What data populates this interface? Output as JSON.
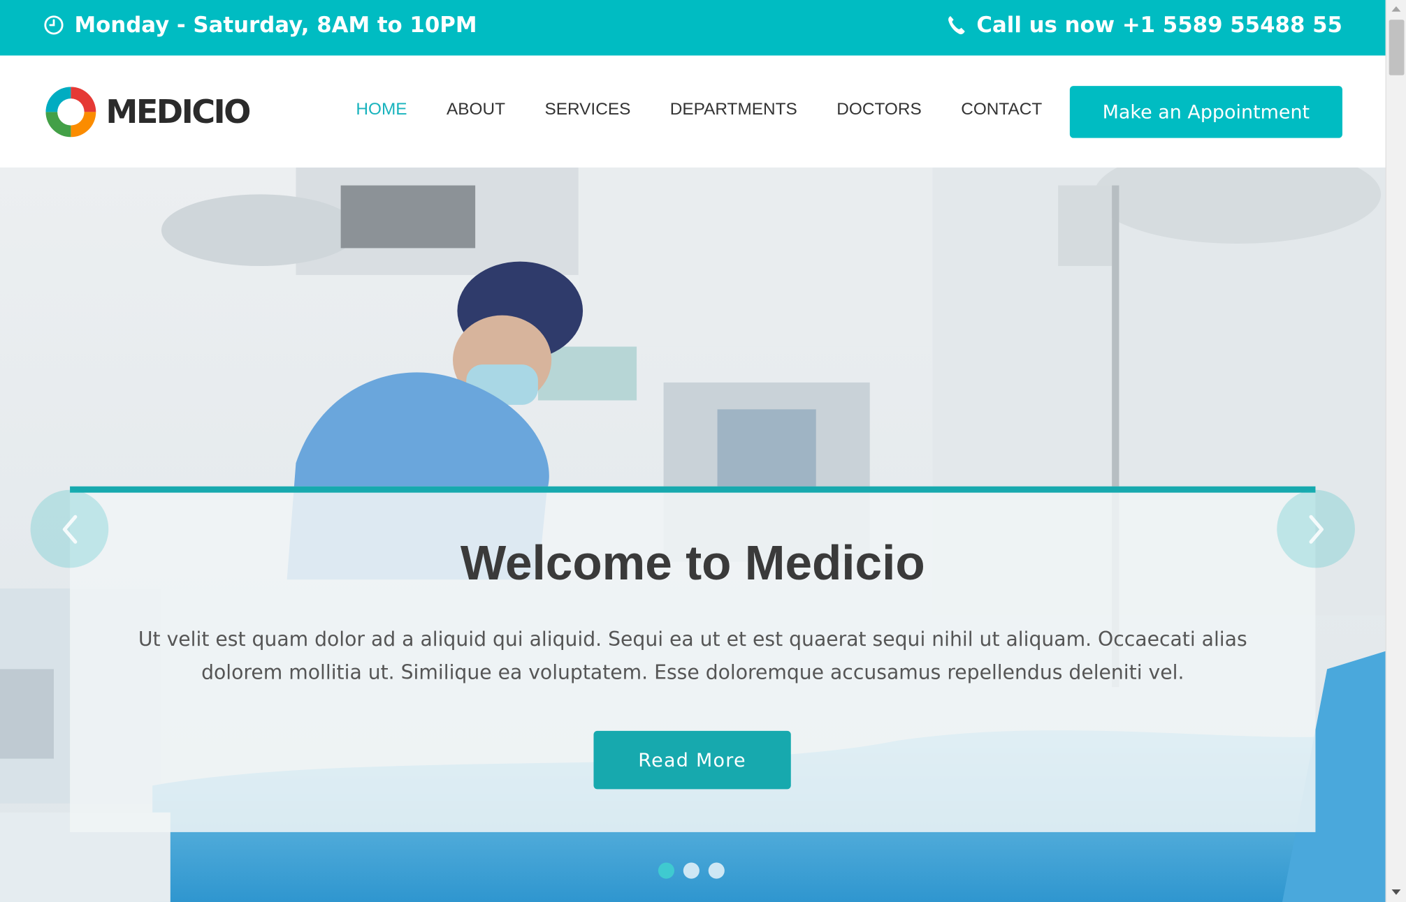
{
  "topbar": {
    "hours": "Monday - Saturday, 8AM to 10PM",
    "phone": "Call us now +1 5589 55488 55",
    "hours_icon": "clock-icon",
    "phone_icon": "phone-icon"
  },
  "header": {
    "logo_text": "MEDICIO",
    "nav": [
      "HOME",
      "ABOUT",
      "SERVICES",
      "DEPARTMENTS",
      "DOCTORS",
      "CONTACT"
    ],
    "active_nav": "HOME",
    "cta": "Make an Appointment"
  },
  "hero": {
    "title": "Welcome to Medicio",
    "description": "Ut velit est quam dolor ad a aliquid qui aliquid. Sequi ea ut et est quaerat sequi nihil ut aliquam. Occaecati alias dolorem mollitia ut. Similique ea voluptatem. Esse doloremque accusamus repellendus deleniti vel.",
    "button": "Read More",
    "slide_count": 3,
    "active_slide": 1
  },
  "colors": {
    "accent": "#00bcc2",
    "accent_dark": "#17a9ae",
    "nav_active": "#18b3bd",
    "text_dark": "#333333"
  }
}
